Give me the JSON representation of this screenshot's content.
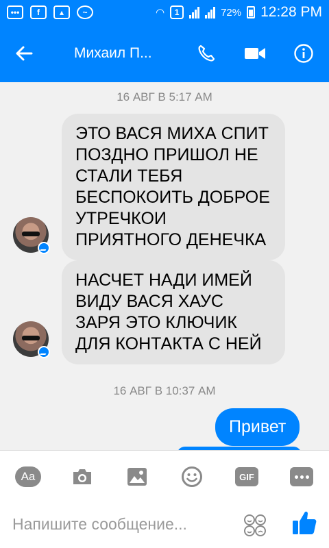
{
  "status_bar": {
    "battery": "72%",
    "time": "12:28 PM",
    "sim_badge": "1"
  },
  "header": {
    "contact_name": "Михаил П...",
    "icons": [
      "back-arrow-icon",
      "phone-icon",
      "video-icon",
      "info-icon"
    ]
  },
  "chat": {
    "messages": [
      {
        "type": "timestamp",
        "text": "16 АВГ В 5:17 AM"
      },
      {
        "type": "incoming",
        "text": "ЭТО ВАСЯ МИХА СПИТ ПОЗДНО ПРИШОЛ НЕ СТАЛИ ТЕБЯ БЕСПОКОИТЬ ДОБРОЕ УТРЕЧКОИ ПРИЯТНОГО ДЕНЕЧКА"
      },
      {
        "type": "incoming",
        "text": "НАСЧЕТ НАДИ ИМЕЙ ВИДУ ВАСЯ ХАУС ЗАРЯ ЭТО КЛЮЧИК ДЛЯ КОНТАКТА С НЕЙ"
      },
      {
        "type": "timestamp",
        "text": "16 АВГ В 10:37 AM"
      },
      {
        "type": "outgoing",
        "text": "Привет"
      }
    ]
  },
  "composer": {
    "placeholder": "Напишите сообщение...",
    "aa_label": "Aa",
    "gif_label": "GIF"
  },
  "colors": {
    "brand": "#0084ff",
    "incoming_bubble": "#e4e4e4",
    "background": "#f1f1f1"
  }
}
